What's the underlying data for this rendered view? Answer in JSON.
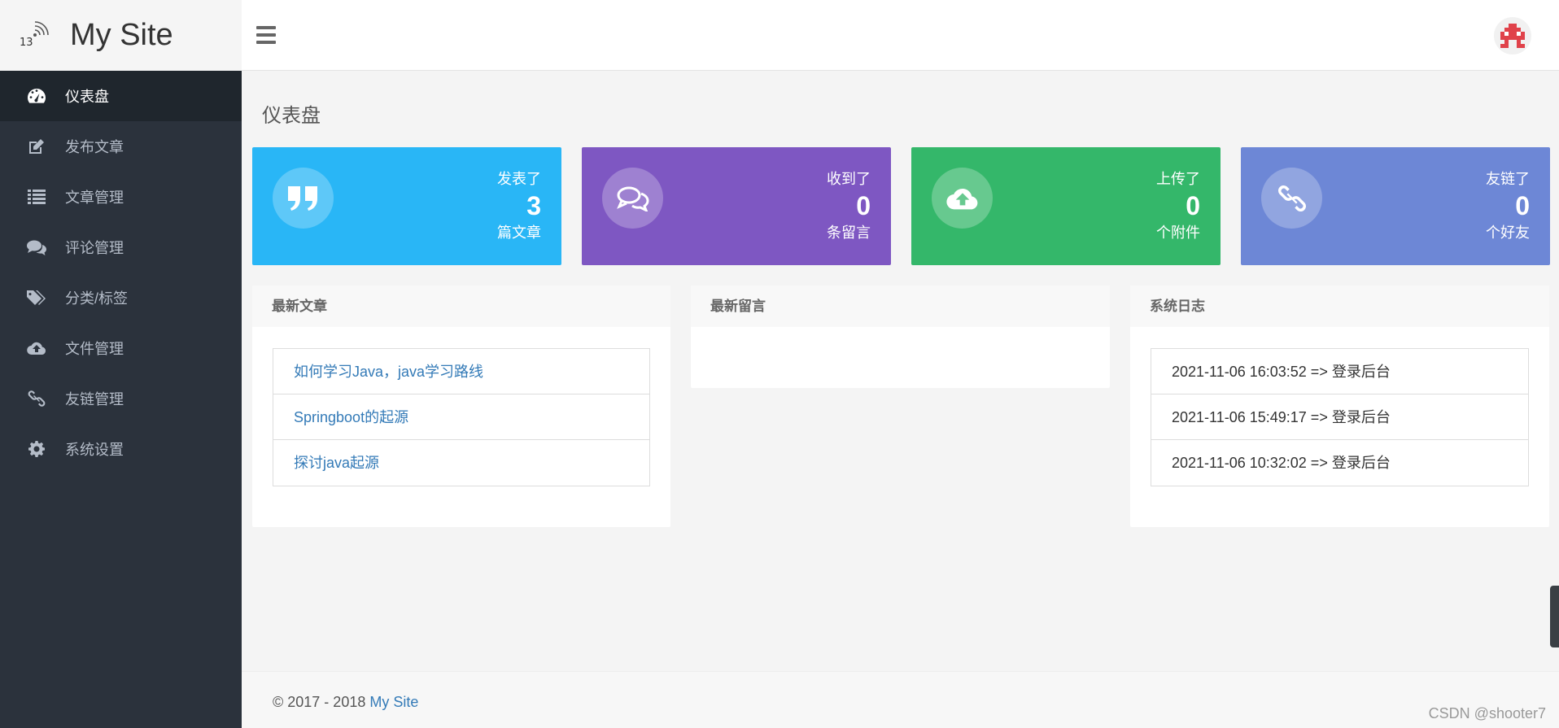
{
  "logo": {
    "badge_number": "13",
    "site_name": "My Site"
  },
  "sidebar": {
    "items": [
      {
        "label": "仪表盘",
        "icon": "dashboard-icon",
        "active": true
      },
      {
        "label": "发布文章",
        "icon": "edit-icon"
      },
      {
        "label": "文章管理",
        "icon": "list-icon"
      },
      {
        "label": "评论管理",
        "icon": "comments-icon"
      },
      {
        "label": "分类/标签",
        "icon": "tags-icon"
      },
      {
        "label": "文件管理",
        "icon": "cloud-upload-icon"
      },
      {
        "label": "友链管理",
        "icon": "link-icon"
      },
      {
        "label": "系统设置",
        "icon": "gear-icon"
      }
    ]
  },
  "page": {
    "title": "仪表盘"
  },
  "stats": [
    {
      "pre": "发表了",
      "value": "3",
      "post": "篇文章",
      "color": "#29b6f6",
      "icon": "quote-icon"
    },
    {
      "pre": "收到了",
      "value": "0",
      "post": "条留言",
      "color": "#7e57c2",
      "icon": "comments-icon"
    },
    {
      "pre": "上传了",
      "value": "0",
      "post": "个附件",
      "color": "#34b76a",
      "icon": "cloud-upload-icon"
    },
    {
      "pre": "友链了",
      "value": "0",
      "post": "个好友",
      "color": "#6d87d6",
      "icon": "link-icon"
    }
  ],
  "panels": {
    "latest_articles": {
      "title": "最新文章",
      "items": [
        "如何学习Java，java学习路线",
        "Springboot的起源",
        "探讨java起源"
      ]
    },
    "latest_comments": {
      "title": "最新留言",
      "items": []
    },
    "system_logs": {
      "title": "系统日志",
      "items": [
        "2021-11-06 16:03:52 => 登录后台",
        "2021-11-06 15:49:17 => 登录后台",
        "2021-11-06 10:32:02 => 登录后台"
      ]
    }
  },
  "footer": {
    "copyright": "© 2017 - 2018 ",
    "site_link": "My Site",
    "watermark": "CSDN @shooter7"
  }
}
